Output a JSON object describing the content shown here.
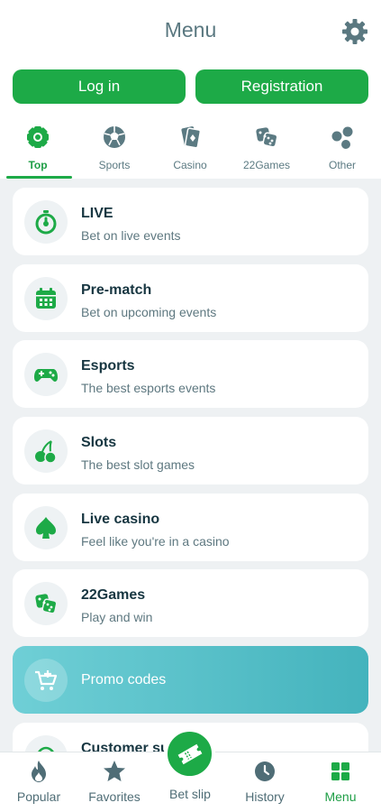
{
  "header": {
    "title": "Menu",
    "settings_icon": "gear-icon"
  },
  "auth": {
    "login_label": "Log in",
    "register_label": "Registration"
  },
  "categories": [
    {
      "label": "Top",
      "icon": "badge-icon",
      "active": true
    },
    {
      "label": "Sports",
      "icon": "soccer-ball-icon",
      "active": false
    },
    {
      "label": "Casino",
      "icon": "cards-icon",
      "active": false
    },
    {
      "label": "22Games",
      "icon": "dice-icon",
      "active": false
    },
    {
      "label": "Other",
      "icon": "bubbles-icon",
      "active": false
    }
  ],
  "menu": [
    {
      "title": "LIVE",
      "subtitle": "Bet on live events",
      "icon": "stopwatch-icon"
    },
    {
      "title": "Pre-match",
      "subtitle": "Bet on upcoming events",
      "icon": "calendar-icon"
    },
    {
      "title": "Esports",
      "subtitle": "The best esports events",
      "icon": "gamepad-icon"
    },
    {
      "title": "Slots",
      "subtitle": "The best slot games",
      "icon": "cherries-icon"
    },
    {
      "title": "Live casino",
      "subtitle": "Feel like you're in a casino",
      "icon": "spade-icon"
    },
    {
      "title": "22Games",
      "subtitle": "Play and win",
      "icon": "dice-icon"
    },
    {
      "title": "Promo codes",
      "subtitle": "",
      "icon": "cart-icon"
    },
    {
      "title": "Customer su",
      "subtitle": "",
      "icon": "headset-icon"
    }
  ],
  "bottom_nav": [
    {
      "label": "Popular",
      "icon": "flame-icon",
      "active": false
    },
    {
      "label": "Favorites",
      "icon": "star-icon",
      "active": false
    },
    {
      "label": "Bet slip",
      "icon": "ticket-icon",
      "active": false
    },
    {
      "label": "History",
      "icon": "clock-icon",
      "active": false
    },
    {
      "label": "Menu",
      "icon": "grid-icon",
      "active": true
    }
  ],
  "colors": {
    "accent": "#1daa47",
    "active_text": "#1e9e46",
    "muted": "#5b7a82",
    "background": "#eef1f3",
    "promo_gradient_start": "#6fcfd6",
    "promo_gradient_end": "#44b3bd"
  }
}
